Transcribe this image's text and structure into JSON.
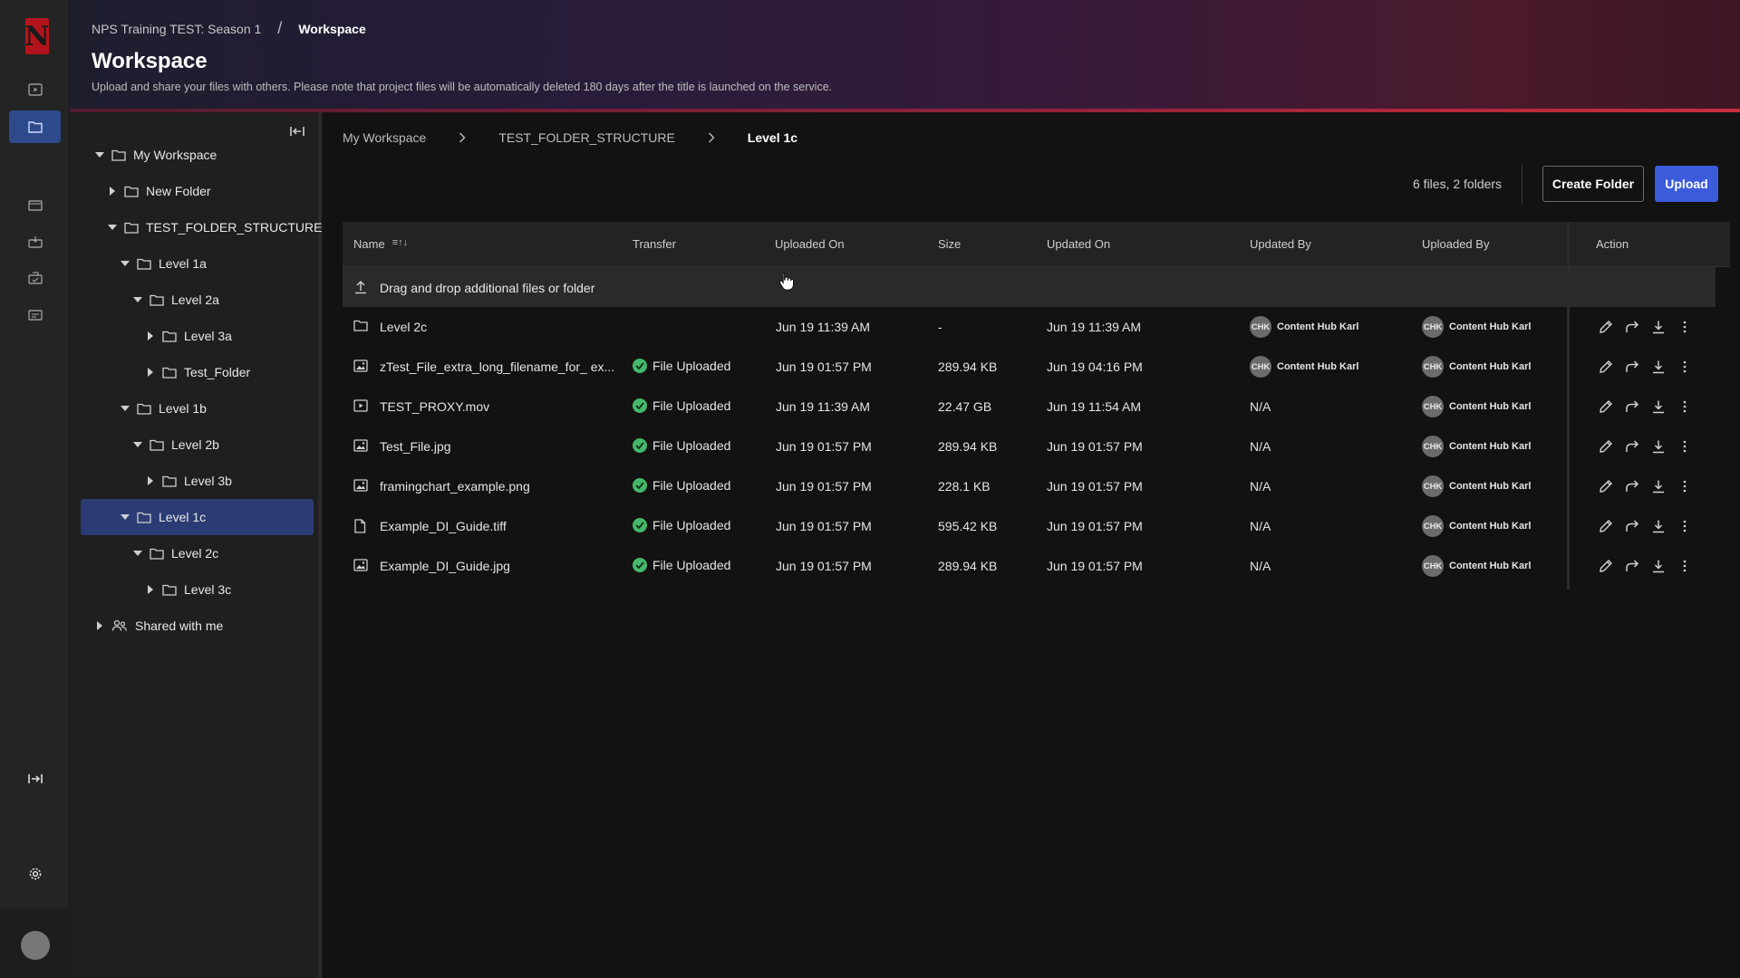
{
  "header": {
    "breadcrumb_project": "NPS Training TEST: Season 1",
    "breadcrumb_sep": "/",
    "breadcrumb_current": "Workspace",
    "title": "Workspace",
    "subtitle": "Upload and share your files with others. Please note that project files will be automatically deleted 180 days after the title is launched on the service."
  },
  "rail": {
    "logo": "N",
    "items": [
      "titles-icon",
      "workspace-icon",
      "media-icon",
      "deliveries-icon",
      "reports-icon",
      "schedule-icon"
    ],
    "active": "workspace-icon"
  },
  "tree": {
    "items": [
      {
        "label": "My Workspace",
        "expanded": true
      },
      {
        "label": "New Folder",
        "expanded": false
      },
      {
        "label": "TEST_FOLDER_STRUCTURE",
        "expanded": true
      },
      {
        "label": "Level 1a",
        "expanded": true
      },
      {
        "label": "Level 2a",
        "expanded": true
      },
      {
        "label": "Level 3a",
        "expanded": false
      },
      {
        "label": "Test_Folder",
        "expanded": false
      },
      {
        "label": "Level 1b",
        "expanded": true
      },
      {
        "label": "Level 2b",
        "expanded": true
      },
      {
        "label": "Level 3b",
        "expanded": false
      },
      {
        "label": "Level 1c",
        "expanded": true,
        "selected": true
      },
      {
        "label": "Level 2c",
        "expanded": true
      },
      {
        "label": "Level 3c",
        "expanded": false
      },
      {
        "label": "Shared with me",
        "expanded": false
      }
    ]
  },
  "breadcrumb": {
    "items": [
      "My Workspace",
      "TEST_FOLDER_STRUCTURE",
      "Level 1c"
    ]
  },
  "toolbar": {
    "counts": "6 files, 2 folders",
    "create_folder": "Create Folder",
    "upload": "Upload"
  },
  "table": {
    "columns": {
      "name": "Name",
      "sort": "≡↑↓",
      "transfer": "Transfer",
      "uploaded_on": "Uploaded On",
      "size": "Size",
      "updated_on": "Updated On",
      "updated_by": "Updated By",
      "uploaded_by": "Uploaded By",
      "action": "Action"
    },
    "dropzone": "Drag and drop additional files or folder",
    "rows": [
      {
        "icon": "folder-icon",
        "name": "Level 2c",
        "transfer": "",
        "uploaded_on": "Jun 19 11:39 AM",
        "size": "-",
        "updated_on": "Jun 19 11:39 AM",
        "updated_by": "Content Hub Karl",
        "updated_by_initials": "CHK",
        "uploaded_by": "Content Hub Karl",
        "uploaded_by_initials": "CHK"
      },
      {
        "icon": "image-file-icon",
        "name": "zTest_File_extra_long_filename_for_ ex...",
        "transfer": "File Uploaded",
        "uploaded_on": "Jun 19 01:57 PM",
        "size": "289.94 KB",
        "updated_on": "Jun 19 04:16 PM",
        "updated_by": "Content Hub Karl",
        "updated_by_initials": "CHK",
        "uploaded_by": "Content Hub Karl",
        "uploaded_by_initials": "CHK"
      },
      {
        "icon": "video-file-icon",
        "name": "TEST_PROXY.mov",
        "transfer": "File Uploaded",
        "uploaded_on": "Jun 19 11:39 AM",
        "size": "22.47 GB",
        "updated_on": "Jun 19 11:54 AM",
        "updated_by": "N/A",
        "updated_by_initials": "",
        "uploaded_by": "Content Hub Karl",
        "uploaded_by_initials": "CHK"
      },
      {
        "icon": "image-file-icon",
        "name": "Test_File.jpg",
        "transfer": "File Uploaded",
        "uploaded_on": "Jun 19 01:57 PM",
        "size": "289.94 KB",
        "updated_on": "Jun 19 01:57 PM",
        "updated_by": "N/A",
        "updated_by_initials": "",
        "uploaded_by": "Content Hub Karl",
        "uploaded_by_initials": "CHK"
      },
      {
        "icon": "image-file-icon",
        "name": "framingchart_example.png",
        "transfer": "File Uploaded",
        "uploaded_on": "Jun 19 01:57 PM",
        "size": "228.1 KB",
        "updated_on": "Jun 19 01:57 PM",
        "updated_by": "N/A",
        "updated_by_initials": "",
        "uploaded_by": "Content Hub Karl",
        "uploaded_by_initials": "CHK"
      },
      {
        "icon": "document-file-icon",
        "name": "Example_DI_Guide.tiff",
        "transfer": "File Uploaded",
        "uploaded_on": "Jun 19 01:57 PM",
        "size": "595.42 KB",
        "updated_on": "Jun 19 01:57 PM",
        "updated_by": "N/A",
        "updated_by_initials": "",
        "uploaded_by": "Content Hub Karl",
        "uploaded_by_initials": "CHK"
      },
      {
        "icon": "image-file-icon",
        "name": "Example_DI_Guide.jpg",
        "transfer": "File Uploaded",
        "uploaded_on": "Jun 19 01:57 PM",
        "size": "289.94 KB",
        "updated_on": "Jun 19 01:57 PM",
        "updated_by": "N/A",
        "updated_by_initials": "",
        "uploaded_by": "Content Hub Karl",
        "uploaded_by_initials": "CHK"
      }
    ],
    "row_actions": [
      "edit-icon",
      "share-icon",
      "download-icon",
      "more-icon"
    ]
  },
  "colors": {
    "accent": "#3b5bdb",
    "selected_tree": "#2b3c74",
    "success": "#46b86a",
    "brand": "#b3141b"
  }
}
